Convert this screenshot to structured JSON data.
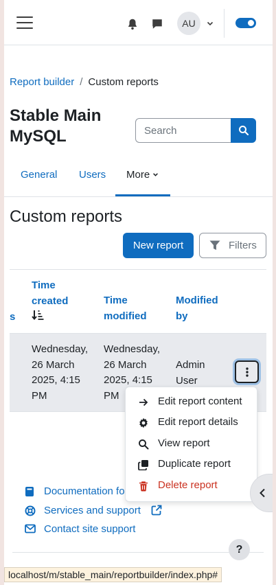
{
  "navbar": {
    "avatar_initials": "AU"
  },
  "breadcrumb": {
    "items": [
      "Report builder",
      "Custom reports"
    ],
    "separator": "/"
  },
  "header": {
    "title": "Stable Main MySQL",
    "search_placeholder": "Search"
  },
  "tabs": {
    "items": [
      "General",
      "Users",
      "More"
    ],
    "active": "More"
  },
  "section": {
    "title": "Custom reports",
    "new_report_label": "New report",
    "filters_label": "Filters"
  },
  "table": {
    "columns": {
      "partial": "s",
      "time_created": "Time created",
      "time_modified": "Time modified",
      "modified_by": "Modified by"
    },
    "rows": [
      {
        "time_created": "Wednesday, 26 March 2025, 4:15 PM",
        "time_modified": "Wednesday, 26 March 2025, 4:15 PM",
        "modified_by": "Admin User"
      }
    ]
  },
  "menu": {
    "items": [
      {
        "label": "Edit report content",
        "icon": "arrow-right-icon"
      },
      {
        "label": "Edit report details",
        "icon": "gear-icon"
      },
      {
        "label": "View report",
        "icon": "search-icon"
      },
      {
        "label": "Duplicate report",
        "icon": "copy-icon"
      },
      {
        "label": "Delete report",
        "icon": "trash-icon"
      }
    ]
  },
  "footer": {
    "documentation_label": "Documentation fo",
    "services_label": "Services and support",
    "contact_label": "Contact site support",
    "help_label": "?"
  },
  "status_bar": {
    "url": "localhost/m/stable_main/reportbuilder/index.php#"
  },
  "colors": {
    "primary": "#0f6cbf",
    "danger": "#ca3120",
    "row_highlight": "#e8eaee"
  }
}
